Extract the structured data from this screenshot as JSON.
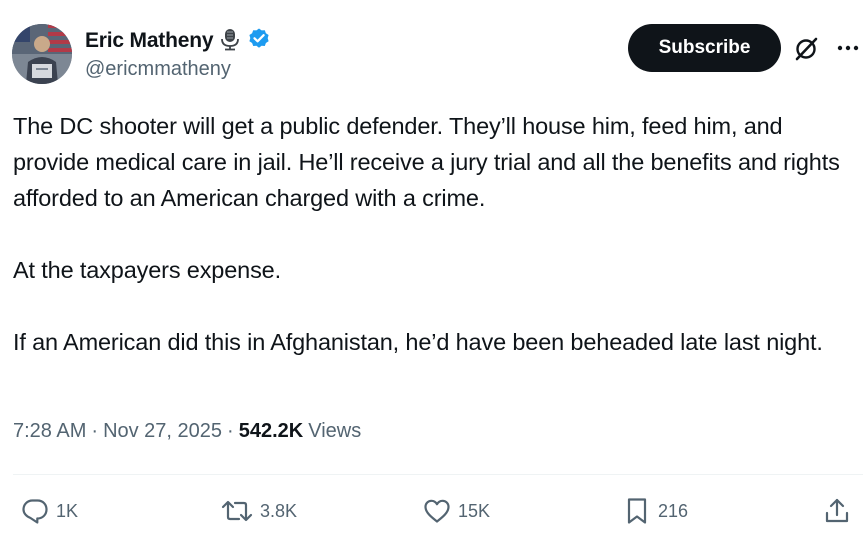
{
  "author": {
    "display_name": "Eric Matheny",
    "handle": "@ericmmatheny",
    "verified_badge_color": "#1d9bf0"
  },
  "header": {
    "subscribe_label": "Subscribe"
  },
  "tweet": {
    "text": "The DC shooter will get a public defender. They’ll house him, feed him, and provide medical care in jail. He’ll receive a jury trial and all the benefits and rights afforded to an American charged with a crime.\n\nAt the taxpayers expense.\n\nIf an American did this in Afghanistan, he’d have been beheaded late last night."
  },
  "meta": {
    "time": "7:28 AM",
    "separator": "·",
    "date": "Nov 27, 2025",
    "views_count": "542.2K",
    "views_label": "Views"
  },
  "actions": {
    "replies": "1K",
    "reposts": "3.8K",
    "likes": "15K",
    "bookmarks": "216"
  },
  "icons": {
    "podcast": "microphone-icon",
    "verified": "verified-badge-icon",
    "grok": "grok-icon",
    "more": "more-options-icon",
    "reply": "reply-icon",
    "repost": "repost-icon",
    "like": "heart-icon",
    "bookmark": "bookmark-icon",
    "share": "share-icon"
  },
  "colors": {
    "text_primary": "#0f1419",
    "text_secondary": "#536471",
    "divider": "#eff3f4",
    "subscribe_bg": "#0f1419"
  }
}
